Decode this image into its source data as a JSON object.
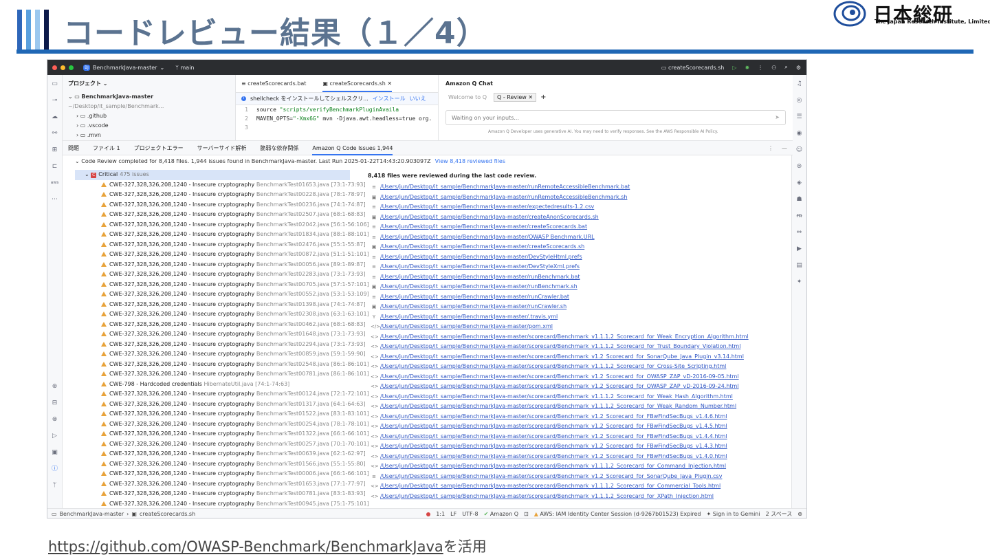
{
  "slide": {
    "title": "コードレビュー結果（１／4）",
    "bar_colors": [
      "#2e66b9",
      "#5aa0de",
      "#9cc8ef",
      "#0d1a4a"
    ],
    "logo_jp": "日本総研",
    "logo_en": "The Japan Research Institute, Limited",
    "footer_link": "https://github.com/OWASP-Benchmark/BenchmarkJava",
    "footer_suffix": "を活用"
  },
  "ide": {
    "project_badge": "BJ",
    "project_name": "BenchmarkJava-master",
    "branch": "main",
    "run_config": "createScorecards.sh",
    "project_panel_title": "プロジェクト",
    "tree": [
      {
        "label": "BenchmarkJava-master",
        "path": "~/Desktop/it_sample/Benchmark..."
      },
      {
        "label": ".github"
      },
      {
        "label": ".vscode"
      },
      {
        "label": ".mvn"
      }
    ],
    "editor_tabs": [
      "createScorecards.bat",
      "createScorecards.sh"
    ],
    "notice": {
      "text": "shellcheck をインストールしてシェルスクリ...",
      "install": "インストール",
      "no": "いいえ"
    },
    "code_lines": [
      {
        "n": "1",
        "pre": "source ",
        "str": "\"scripts/verifyBenchmarkPluginAvaila"
      },
      {
        "n": "2",
        "pre": "MAVEN_OPTS=",
        "str": "\"-Xmx6G\"",
        "post": " mvn -Djava.awt.headless=true org."
      },
      {
        "n": "3",
        "pre": "",
        "str": ""
      }
    ],
    "chat": {
      "title": "Amazon Q Chat",
      "tab1": "Welcome to Q",
      "tab2": "Q - Review",
      "input_placeholder": "Waiting on your inputs...",
      "foot": "Amazon Q Developer uses generative AI. You may need to verify responses. See the AWS Responsible AI Policy."
    },
    "bottom_tabs": [
      "問題",
      "ファイル 1",
      "プロジェクトエラー",
      "サーバーサイド解析",
      "脆弱な依存関係",
      "Amazon Q Code Issues 1,944"
    ],
    "summary": "Code Review completed for 8,418 files. 1,944 issues found in BenchmarkJava-master. Last Run 2025-01-22T14:43:20.903097Z",
    "summary_link": "View 8,418 reviewed files",
    "critical_label": "Critical",
    "critical_count": "475 issues",
    "issues": [
      {
        "text": "CWE-327,328,326,208,1240 - Insecure cryptography",
        "file": "BenchmarkTest01653.java [73:1-73:93]"
      },
      {
        "text": "CWE-327,328,326,208,1240 - Insecure cryptography",
        "file": "BenchmarkTest00228.java [78:1-78:97]"
      },
      {
        "text": "CWE-327,328,326,208,1240 - Insecure cryptography",
        "file": "BenchmarkTest00236.java [74:1-74:87]"
      },
      {
        "text": "CWE-327,328,326,208,1240 - Insecure cryptography",
        "file": "BenchmarkTest02507.java [68:1-68:83]"
      },
      {
        "text": "CWE-327,328,326,208,1240 - Insecure cryptography",
        "file": "BenchmarkTest02042.java [56:1-56:106]"
      },
      {
        "text": "CWE-327,328,326,208,1240 - Insecure cryptography",
        "file": "BenchmarkTest01834.java [88:1-88:101]"
      },
      {
        "text": "CWE-327,328,326,208,1240 - Insecure cryptography",
        "file": "BenchmarkTest02476.java [55:1-55:87]"
      },
      {
        "text": "CWE-327,328,326,208,1240 - Insecure cryptography",
        "file": "BenchmarkTest00872.java [51:1-51:101]"
      },
      {
        "text": "CWE-327,328,326,208,1240 - Insecure cryptography",
        "file": "BenchmarkTest00056.java [89:1-89:87]"
      },
      {
        "text": "CWE-327,328,326,208,1240 - Insecure cryptography",
        "file": "BenchmarkTest02283.java [73:1-73:93]"
      },
      {
        "text": "CWE-327,328,326,208,1240 - Insecure cryptography",
        "file": "BenchmarkTest00705.java [57:1-57:101]"
      },
      {
        "text": "CWE-327,328,326,208,1240 - Insecure cryptography",
        "file": "BenchmarkTest00552.java [53:1-53:109]"
      },
      {
        "text": "CWE-327,328,326,208,1240 - Insecure cryptography",
        "file": "BenchmarkTest01398.java [74:1-74:87]"
      },
      {
        "text": "CWE-327,328,326,208,1240 - Insecure cryptography",
        "file": "BenchmarkTest02308.java [63:1-63:101]"
      },
      {
        "text": "CWE-327,328,326,208,1240 - Insecure cryptography",
        "file": "BenchmarkTest00462.java [68:1-68:83]"
      },
      {
        "text": "CWE-327,328,326,208,1240 - Insecure cryptography",
        "file": "BenchmarkTest01648.java [73:1-73:93]"
      },
      {
        "text": "CWE-327,328,326,208,1240 - Insecure cryptography",
        "file": "BenchmarkTest02294.java [73:1-73:93]"
      },
      {
        "text": "CWE-327,328,326,208,1240 - Insecure cryptography",
        "file": "BenchmarkTest00859.java [59:1-59:90]"
      },
      {
        "text": "CWE-327,328,326,208,1240 - Insecure cryptography",
        "file": "BenchmarkTest02548.java [86:1-86:101]"
      },
      {
        "text": "CWE-327,328,326,208,1240 - Insecure cryptography",
        "file": "BenchmarkTest00781.java [86:1-86:101]"
      },
      {
        "text": "CWE-798 - Hardcoded credentials",
        "file": "HibernateUtil.java [74:1-74:63]"
      },
      {
        "text": "CWE-327,328,326,208,1240 - Insecure cryptography",
        "file": "BenchmarkTest00124.java [72:1-72:101]"
      },
      {
        "text": "CWE-327,328,326,208,1240 - Insecure cryptography",
        "file": "BenchmarkTest01317.java [64:1-64:63]"
      },
      {
        "text": "CWE-327,328,326,208,1240 - Insecure cryptography",
        "file": "BenchmarkTest01522.java [83:1-83:101]"
      },
      {
        "text": "CWE-327,328,326,208,1240 - Insecure cryptography",
        "file": "BenchmarkTest00254.java [78:1-78:101]"
      },
      {
        "text": "CWE-327,328,326,208,1240 - Insecure cryptography",
        "file": "BenchmarkTest01322.java [66:1-66:101]"
      },
      {
        "text": "CWE-327,328,326,208,1240 - Insecure cryptography",
        "file": "BenchmarkTest00257.java [70:1-70:101]"
      },
      {
        "text": "CWE-327,328,326,208,1240 - Insecure cryptography",
        "file": "BenchmarkTest00639.java [62:1-62:97]"
      },
      {
        "text": "CWE-327,328,326,208,1240 - Insecure cryptography",
        "file": "BenchmarkTest01566.java [55:1-55:80]"
      },
      {
        "text": "CWE-327,328,326,208,1240 - Insecure cryptography",
        "file": "BenchmarkTest00006.java [66:1-66:101]"
      },
      {
        "text": "CWE-327,328,326,208,1240 - Insecure cryptography",
        "file": "BenchmarkTest01653.java [77:1-77:97]"
      },
      {
        "text": "CWE-327,328,326,208,1240 - Insecure cryptography",
        "file": "BenchmarkTest00781.java [83:1-83:93]"
      },
      {
        "text": "CWE-327,328,326,208,1240 - Insecure cryptography",
        "file": "BenchmarkTest00945.java [75:1-75:101]"
      }
    ],
    "files_head": "8,418 files were reviewed during the last code review.",
    "files": [
      {
        "icon": "≡",
        "path": "/Users/jun/Desktop/it_sample/BenchmarkJava-master/runRemoteAccessibleBenchmark.bat"
      },
      {
        "icon": "▣",
        "path": "/Users/jun/Desktop/it_sample/BenchmarkJava-master/runRemoteAccessibleBenchmark.sh"
      },
      {
        "icon": "≡",
        "path": "/Users/jun/Desktop/it_sample/BenchmarkJava-master/expectedresults-1.2.csv"
      },
      {
        "icon": "▣",
        "path": "/Users/jun/Desktop/it_sample/BenchmarkJava-master/createAnonScorecards.sh"
      },
      {
        "icon": "≡",
        "path": "/Users/jun/Desktop/it_sample/BenchmarkJava-master/createScorecards.bat"
      },
      {
        "icon": "≡",
        "path": "/Users/jun/Desktop/it_sample/BenchmarkJava-master/OWASP Benchmark.URL"
      },
      {
        "icon": "▣",
        "path": "/Users/jun/Desktop/it_sample/BenchmarkJava-master/createScorecards.sh"
      },
      {
        "icon": "≡",
        "path": "/Users/jun/Desktop/it_sample/BenchmarkJava-master/DevStyleHtml.prefs"
      },
      {
        "icon": "≡",
        "path": "/Users/jun/Desktop/it_sample/BenchmarkJava-master/DevStyleXml.prefs"
      },
      {
        "icon": "≡",
        "path": "/Users/jun/Desktop/it_sample/BenchmarkJava-master/runBenchmark.bat"
      },
      {
        "icon": "▣",
        "path": "/Users/jun/Desktop/it_sample/BenchmarkJava-master/runBenchmark.sh"
      },
      {
        "icon": "≡",
        "path": "/Users/jun/Desktop/it_sample/BenchmarkJava-master/runCrawler.bat"
      },
      {
        "icon": "▣",
        "path": "/Users/jun/Desktop/it_sample/BenchmarkJava-master/runCrawler.sh"
      },
      {
        "icon": "Y",
        "path": "/Users/jun/Desktop/it_sample/BenchmarkJava-master/.travis.yml"
      },
      {
        "icon": "</>",
        "path": "/Users/jun/Desktop/it_sample/BenchmarkJava-master/pom.xml"
      },
      {
        "icon": "<>",
        "path": "/Users/jun/Desktop/it_sample/BenchmarkJava-master/scorecard/Benchmark_v1.1.1.2_Scorecard_for_Weak_Encryption_Algorithm.html"
      },
      {
        "icon": "<>",
        "path": "/Users/jun/Desktop/it_sample/BenchmarkJava-master/scorecard/Benchmark_v1.1.1.2_Scorecard_for_Trust_Boundary_Violation.html"
      },
      {
        "icon": "<>",
        "path": "/Users/jun/Desktop/it_sample/BenchmarkJava-master/scorecard/Benchmark_v1.2_Scorecard_for_SonarQube_Java_Plugin_v3.14.html"
      },
      {
        "icon": "<>",
        "path": "/Users/jun/Desktop/it_sample/BenchmarkJava-master/scorecard/Benchmark_v1.1.1.2_Scorecard_for_Cross-Site_Scripting.html"
      },
      {
        "icon": "<>",
        "path": "/Users/jun/Desktop/it_sample/BenchmarkJava-master/scorecard/Benchmark_v1.2_Scorecard_for_OWASP_ZAP_vD-2016-09-05.html"
      },
      {
        "icon": "<>",
        "path": "/Users/jun/Desktop/it_sample/BenchmarkJava-master/scorecard/Benchmark_v1.2_Scorecard_for_OWASP_ZAP_vD-2016-09-24.html"
      },
      {
        "icon": "<>",
        "path": "/Users/jun/Desktop/it_sample/BenchmarkJava-master/scorecard/Benchmark_v1.1.1.2_Scorecard_for_Weak_Hash_Algorithm.html"
      },
      {
        "icon": "<>",
        "path": "/Users/jun/Desktop/it_sample/BenchmarkJava-master/scorecard/Benchmark_v1.1.1.2_Scorecard_for_Weak_Random_Number.html"
      },
      {
        "icon": "<>",
        "path": "/Users/jun/Desktop/it_sample/BenchmarkJava-master/scorecard/Benchmark_v1.2_Scorecard_for_FBwFindSecBugs_v1.4.6.html"
      },
      {
        "icon": "<>",
        "path": "/Users/jun/Desktop/it_sample/BenchmarkJava-master/scorecard/Benchmark_v1.2_Scorecard_for_FBwFindSecBugs_v1.4.5.html"
      },
      {
        "icon": "<>",
        "path": "/Users/jun/Desktop/it_sample/BenchmarkJava-master/scorecard/Benchmark_v1.2_Scorecard_for_FBwFindSecBugs_v1.4.4.html"
      },
      {
        "icon": "<>",
        "path": "/Users/jun/Desktop/it_sample/BenchmarkJava-master/scorecard/Benchmark_v1.2_Scorecard_for_FBwFindSecBugs_v1.4.3.html"
      },
      {
        "icon": "<>",
        "path": "/Users/jun/Desktop/it_sample/BenchmarkJava-master/scorecard/Benchmark_v1.2_Scorecard_for_FBwFindSecBugs_v1.4.0.html"
      },
      {
        "icon": "<>",
        "path": "/Users/jun/Desktop/it_sample/BenchmarkJava-master/scorecard/Benchmark_v1.1.1.2_Scorecard_for_Command_Injection.html"
      },
      {
        "icon": "≡",
        "path": "/Users/jun/Desktop/it_sample/BenchmarkJava-master/scorecard/Benchmark_v1.2_Scorecard_for_SonarQube_Java_Plugin.csv"
      },
      {
        "icon": "<>",
        "path": "/Users/jun/Desktop/it_sample/BenchmarkJava-master/scorecard/Benchmark_v1.1.1.2_Scorecard_for_Commercial_Tools.html"
      },
      {
        "icon": "<>",
        "path": "/Users/jun/Desktop/it_sample/BenchmarkJava-master/scorecard/Benchmark_v1.1.1.2_Scorecard_for_XPath_Injection.html"
      }
    ],
    "status": {
      "breadcrumb_root": "BenchmarkJava-master",
      "breadcrumb_file": "createScorecards.sh",
      "pos": "1:1",
      "eol": "LF",
      "enc": "UTF-8",
      "amazon_q": "Amazon Q",
      "aws": "AWS: IAM Identity Center Session (d-9267b01523) Expired",
      "gemini": "Sign in to Gemini",
      "indent": "2 スペース"
    }
  }
}
